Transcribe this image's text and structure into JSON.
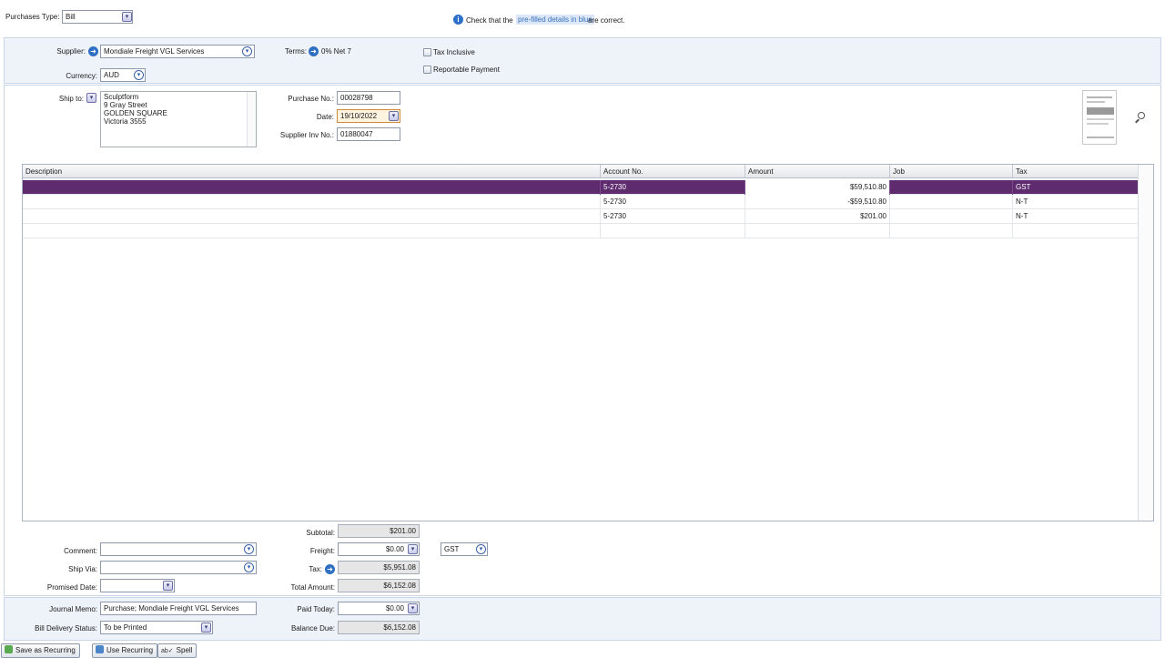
{
  "top": {
    "purchases_type_label": "Purchases Type:",
    "purchases_type_value": "Bill",
    "info_prefix": "Check that the",
    "info_highlight": "pre-filled details in blue",
    "info_suffix": "are correct."
  },
  "supplier": {
    "supplier_label": "Supplier:",
    "supplier_value": "Mondiale Freight VGL Services",
    "currency_label": "Currency:",
    "currency_value": "AUD",
    "terms_label": "Terms:",
    "terms_value": "0% Net 7",
    "tax_inclusive_label": "Tax Inclusive",
    "reportable_payment_label": "Reportable Payment"
  },
  "shipping": {
    "ship_to_label": "Ship to:",
    "ship_to_lines": [
      "Sculptform",
      "9 Gray Street",
      "GOLDEN SQUARE",
      "Victoria  3555"
    ],
    "purchase_no_label": "Purchase No.:",
    "purchase_no_value": "00028798",
    "date_label": "Date:",
    "date_value": "19/10/2022",
    "supplier_inv_label": "Supplier Inv No.:",
    "supplier_inv_value": "01880047"
  },
  "table": {
    "headers": [
      "Description",
      "Account No.",
      "Amount",
      "Job",
      "Tax"
    ],
    "rows": [
      {
        "description": "",
        "account": "5-2730",
        "amount": "$59,510.80",
        "job": "",
        "tax": "GST"
      },
      {
        "description": "",
        "account": "5-2730",
        "amount": "-$59,510.80",
        "job": "",
        "tax": "N-T"
      },
      {
        "description": "",
        "account": "5-2730",
        "amount": "$201.00",
        "job": "",
        "tax": "N-T"
      }
    ]
  },
  "footer": {
    "comment_label": "Comment:",
    "ship_via_label": "Ship Via:",
    "promised_date_label": "Promised Date:",
    "subtotal_label": "Subtotal:",
    "subtotal_value": "$201.00",
    "freight_label": "Freight:",
    "freight_value": "$0.00",
    "freight_tax_code": "GST",
    "tax_label": "Tax:",
    "tax_value": "$5,951.08",
    "total_label": "Total Amount:",
    "total_value": "$6,152.08",
    "journal_memo_label": "Journal Memo:",
    "journal_memo_value": "Purchase; Mondiale Freight VGL Services",
    "bill_delivery_label": "Bill Delivery Status:",
    "bill_delivery_value": "To be Printed",
    "paid_today_label": "Paid Today:",
    "paid_today_value": "$0.00",
    "balance_due_label": "Balance Due:",
    "balance_due_value": "$6,152.08"
  },
  "buttons": {
    "save_recurring": "Save as Recurring",
    "use_recurring": "Use Recurring",
    "spell": "Spell"
  },
  "colors": {
    "selected_row": "#5e2c6e",
    "panel_bg": "#eef3fa",
    "highlight_blue": "#dce8f8"
  }
}
